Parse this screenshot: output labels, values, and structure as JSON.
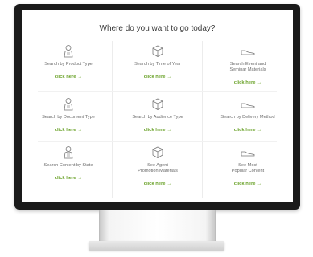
{
  "screen": {
    "heading": "Where do you want to go today?"
  },
  "tiles": [
    {
      "label_line1": "Search by Product Type",
      "label_line2": "",
      "link": "click here",
      "icon": "user-icon"
    },
    {
      "label_line1": "Search by Time of Year",
      "label_line2": "",
      "link": "click here",
      "icon": "cube-icon"
    },
    {
      "label_line1": "Search Event and",
      "label_line2": "Seminar Materials",
      "link": "click here",
      "icon": "shoe-icon"
    },
    {
      "label_line1": "Search by Document Type",
      "label_line2": "",
      "link": "click here",
      "icon": "user-icon"
    },
    {
      "label_line1": "Search by Audience Type",
      "label_line2": "",
      "link": "click here",
      "icon": "cube-icon"
    },
    {
      "label_line1": "Search by Delivery Method",
      "label_line2": "",
      "link": "click here",
      "icon": "shoe-icon"
    },
    {
      "label_line1": "Search Content by State",
      "label_line2": "",
      "link": "click here",
      "icon": "user-icon"
    },
    {
      "label_line1": "See Agent",
      "label_line2": "Promotion Materials",
      "link": "click here",
      "icon": "cube-icon"
    },
    {
      "label_line1": "See Most",
      "label_line2": "Popular Content",
      "link": "click here",
      "icon": "shoe-icon"
    }
  ],
  "link_arrow": "→",
  "colors": {
    "accent": "#6aa229",
    "frame": "#1a1a1a"
  }
}
